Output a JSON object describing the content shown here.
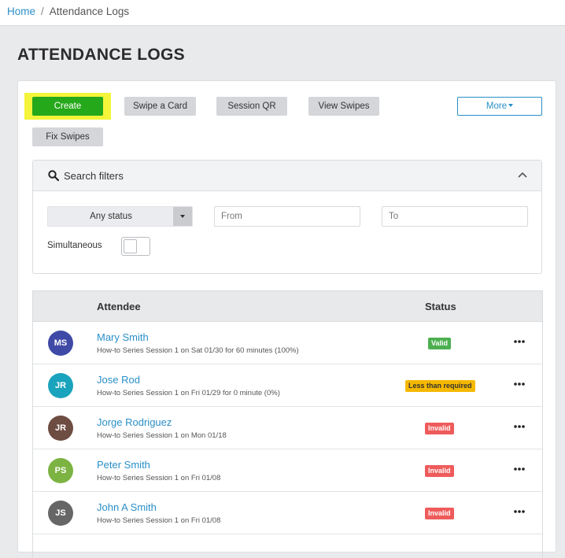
{
  "breadcrumb": {
    "home": "Home",
    "separator": "/",
    "current": "Attendance Logs"
  },
  "page": {
    "title": "ATTENDANCE LOGS"
  },
  "toolbar": {
    "create_label": "Create",
    "swipe_card_label": "Swipe a Card",
    "session_qr_label": "Session QR",
    "view_swipes_label": "View Swipes",
    "more_label": "More",
    "fix_swipes_label": "Fix Swipes"
  },
  "filters": {
    "title": "Search filters",
    "status_value": "Any status",
    "from_placeholder": "From",
    "to_placeholder": "To",
    "simultaneous_label": "Simultaneous",
    "simultaneous_on": false
  },
  "table": {
    "headers": {
      "attendee": "Attendee",
      "status": "Status"
    },
    "rows": [
      {
        "initials": "MS",
        "avatar_color": "#3f4aa6",
        "name": "Mary Smith",
        "detail": "How-to Series Session 1 on Sat 01/30 for 60 minutes (100%)",
        "status": "Valid",
        "status_color": "#4caf50"
      },
      {
        "initials": "JR",
        "avatar_color": "#1aa3bc",
        "name": "Jose Rod",
        "detail": "How-to Series Session 1 on Fri 01/29 for 0 minute (0%)",
        "status": "Less than required",
        "status_color": "#f5b800"
      },
      {
        "initials": "JR",
        "avatar_color": "#6d4c41",
        "name": "Jorge Rodriguez",
        "detail": "How-to Series Session 1 on Mon 01/18",
        "status": "Invalid",
        "status_color": "#ef5b5b"
      },
      {
        "initials": "PS",
        "avatar_color": "#7cb342",
        "name": "Peter Smith",
        "detail": "How-to Series Session 1 on Fri 01/08",
        "status": "Invalid",
        "status_color": "#ef5b5b"
      },
      {
        "initials": "JS",
        "avatar_color": "#666666",
        "name": "John A Smith",
        "detail": "How-to Series Session 1 on Fri 01/08",
        "status": "Invalid",
        "status_color": "#ef5b5b"
      }
    ]
  }
}
